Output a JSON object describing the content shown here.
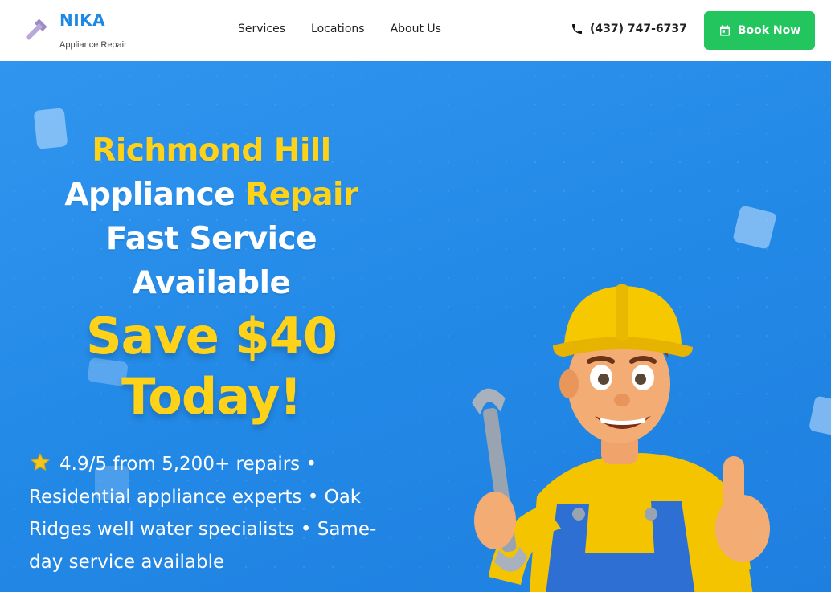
{
  "brand": {
    "name": "NIKA",
    "subtitle": "Appliance Repair",
    "icon": "wrench-icon"
  },
  "nav": {
    "items": [
      {
        "label": "Services"
      },
      {
        "label": "Locations"
      },
      {
        "label": "About Us"
      }
    ]
  },
  "contact": {
    "phone": "(437) 747-6737",
    "icon": "phone-icon"
  },
  "cta": {
    "label": "Book Now",
    "icon": "calendar-icon",
    "color": "#22c55e"
  },
  "hero": {
    "title_line1": "Richmond Hill",
    "title_line2_white": "Appliance ",
    "title_line2_yellow": "Repair",
    "title_line3": "Fast Service",
    "title_line4": "Available",
    "save_line1": "Save $40",
    "save_line2": "Today!",
    "rating_icon": "star-icon",
    "rating_text": "4.9/5 from 5,200+ repairs • Residential appliance experts • Oak Ridges well water specialists • Same-day service available",
    "illustration": "repair-technician-mascot-illustration"
  },
  "colors": {
    "primary_blue": "#1e88e5",
    "hero_bg": "#2288e6",
    "accent_yellow": "#ffd21a",
    "text_white": "#ffffff"
  }
}
